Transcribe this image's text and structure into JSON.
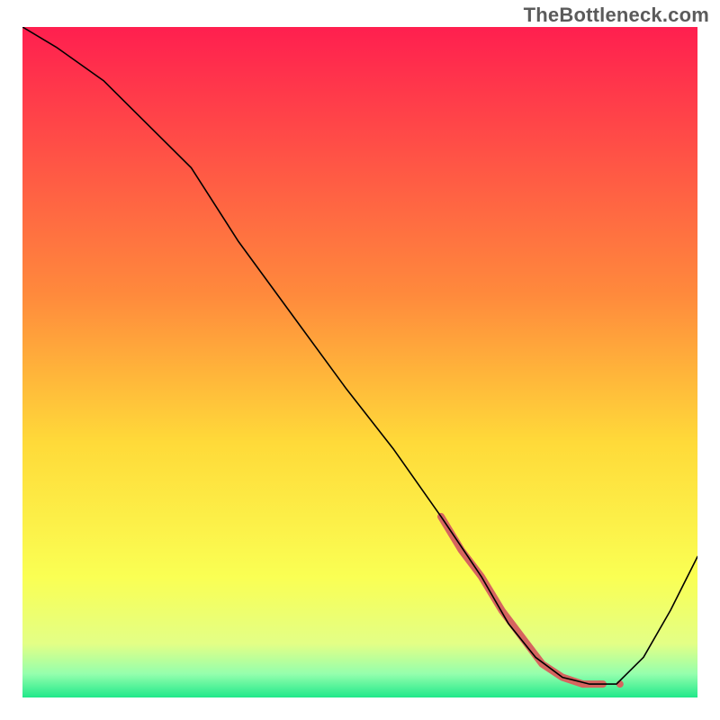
{
  "watermark": "TheBottleneck.com",
  "chart_data": {
    "type": "line",
    "title": "",
    "xlabel": "",
    "ylabel": "",
    "xlim": [
      0,
      100
    ],
    "ylim": [
      0,
      100
    ],
    "grid": false,
    "legend": false,
    "gradient_stops": [
      {
        "offset": 0.0,
        "color": "#ff1f4f"
      },
      {
        "offset": 0.4,
        "color": "#ff8a3c"
      },
      {
        "offset": 0.62,
        "color": "#ffda39"
      },
      {
        "offset": 0.82,
        "color": "#faff53"
      },
      {
        "offset": 0.92,
        "color": "#e3ff86"
      },
      {
        "offset": 0.965,
        "color": "#94ffad"
      },
      {
        "offset": 1.0,
        "color": "#20e88a"
      }
    ],
    "series": [
      {
        "name": "bottleneck-curve",
        "stroke": "#000000",
        "stroke_width": 1.6,
        "x": [
          0,
          5,
          12,
          20,
          25,
          32,
          40,
          48,
          55,
          62,
          68,
          72,
          76,
          80,
          84,
          88,
          92,
          96,
          100
        ],
        "y": [
          100,
          97,
          92,
          84,
          79,
          68,
          57,
          46,
          37,
          27,
          18,
          11,
          6,
          3,
          2,
          2,
          6,
          13,
          21
        ]
      },
      {
        "name": "highlight-segment",
        "stroke": "#d6645f",
        "stroke_width": 8,
        "x": [
          62,
          65,
          68,
          71,
          74,
          77,
          80,
          83,
          86
        ],
        "y": [
          27,
          22,
          18,
          13,
          9,
          5,
          3,
          2,
          2
        ]
      }
    ]
  }
}
